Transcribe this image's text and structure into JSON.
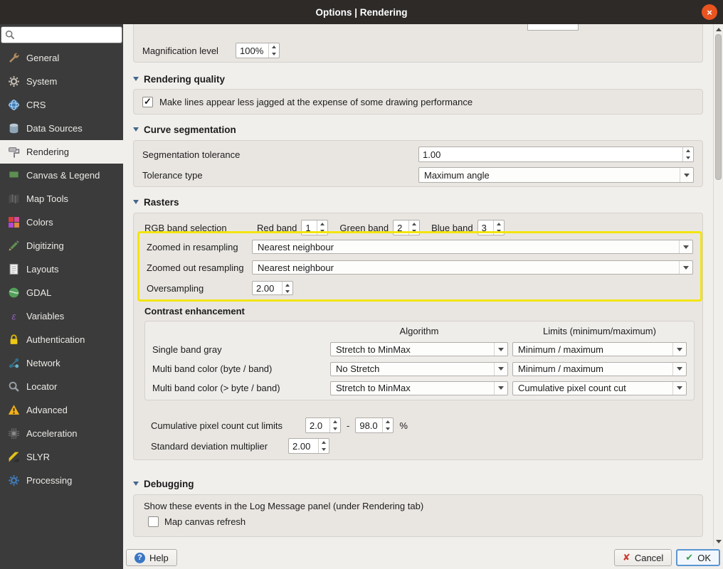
{
  "window": {
    "title": "Options | Rendering",
    "close_label": "×"
  },
  "colors": {
    "highlight_yellow": "#f2e50f",
    "close_button": "#e95420",
    "ok_focus_border": "#5a96d2"
  },
  "sidebar": {
    "search_placeholder": "",
    "items": [
      {
        "label": "General",
        "icon": "wrench-icon"
      },
      {
        "label": "System",
        "icon": "gears-icon"
      },
      {
        "label": "CRS",
        "icon": "globe-icon"
      },
      {
        "label": "Data Sources",
        "icon": "database-icon"
      },
      {
        "label": "Rendering",
        "icon": "paint-roller-icon",
        "selected": true
      },
      {
        "label": "Canvas & Legend",
        "icon": "monitor-icon"
      },
      {
        "label": "Map Tools",
        "icon": "map-icon"
      },
      {
        "label": "Colors",
        "icon": "palette-icon"
      },
      {
        "label": "Digitizing",
        "icon": "pencil-icon"
      },
      {
        "label": "Layouts",
        "icon": "page-icon"
      },
      {
        "label": "GDAL",
        "icon": "gdal-globe-icon"
      },
      {
        "label": "Variables",
        "icon": "epsilon-icon"
      },
      {
        "label": "Authentication",
        "icon": "lock-icon"
      },
      {
        "label": "Network",
        "icon": "network-icon"
      },
      {
        "label": "Locator",
        "icon": "magnifier-icon"
      },
      {
        "label": "Advanced",
        "icon": "warning-icon"
      },
      {
        "label": "Acceleration",
        "icon": "chip-icon"
      },
      {
        "label": "SLYR",
        "icon": "slyr-icon"
      },
      {
        "label": "Processing",
        "icon": "gear-blue-icon"
      }
    ]
  },
  "content": {
    "magnification": {
      "label": "Magnification level",
      "value": "100%"
    },
    "rendering_quality": {
      "title": "Rendering quality",
      "antialias_label": "Make lines appear less jagged at the expense of some drawing performance",
      "antialias_checked": true
    },
    "curve_segmentation": {
      "title": "Curve segmentation",
      "segmentation_tolerance_label": "Segmentation tolerance",
      "segmentation_tolerance_value": "1.00",
      "tolerance_type_label": "Tolerance type",
      "tolerance_type_value": "Maximum angle"
    },
    "rasters": {
      "title": "Rasters",
      "rgb_band_label": "RGB band selection",
      "red_band_label": "Red band",
      "red_band_value": "1",
      "green_band_label": "Green band",
      "green_band_value": "2",
      "blue_band_label": "Blue band",
      "blue_band_value": "3",
      "zoomed_in_label": "Zoomed in resampling",
      "zoomed_in_value": "Nearest neighbour",
      "zoomed_out_label": "Zoomed out resampling",
      "zoomed_out_value": "Nearest neighbour",
      "oversampling_label": "Oversampling",
      "oversampling_value": "2.00",
      "contrast": {
        "title": "Contrast enhancement",
        "algorithm_header": "Algorithm",
        "limits_header": "Limits (minimum/maximum)",
        "rows": [
          {
            "label": "Single band gray",
            "algorithm": "Stretch to MinMax",
            "limits": "Minimum / maximum"
          },
          {
            "label": "Multi band color (byte / band)",
            "algorithm": "No Stretch",
            "limits": "Minimum / maximum"
          },
          {
            "label": "Multi band color (> byte / band)",
            "algorithm": "Stretch to MinMax",
            "limits": "Cumulative pixel count cut"
          }
        ]
      },
      "cumulative_label": "Cumulative pixel count cut limits",
      "cumulative_min": "2.0",
      "cumulative_separator": "-",
      "cumulative_max": "98.0",
      "cumulative_unit": "%",
      "stddev_label": "Standard deviation multiplier",
      "stddev_value": "2.00"
    },
    "debugging": {
      "title": "Debugging",
      "description": "Show these events in the Log Message panel (under Rendering tab)",
      "map_canvas_refresh_label": "Map canvas refresh",
      "map_canvas_refresh_checked": false
    }
  },
  "footer": {
    "help_label": "Help",
    "cancel_label": "Cancel",
    "ok_label": "OK"
  }
}
